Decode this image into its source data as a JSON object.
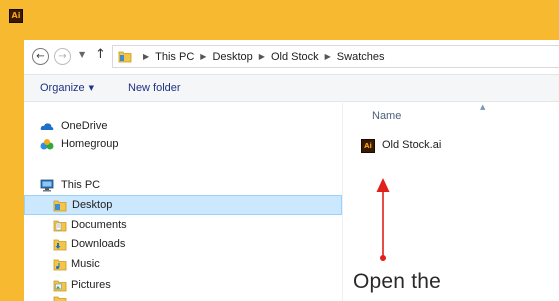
{
  "window": {
    "app_icon_text": "Ai",
    "accent_color": "#f6b92f"
  },
  "address_bar": {
    "back_icon": "back-arrow-icon",
    "forward_icon": "forward-arrow-icon",
    "up_icon": "up-arrow-icon",
    "breadcrumbs": [
      "This PC",
      "Desktop",
      "Old Stock",
      "Swatches"
    ]
  },
  "toolbar": {
    "organize_label": "Organize",
    "new_folder_label": "New folder"
  },
  "nav_pane": {
    "items": [
      {
        "label": "OneDrive",
        "icon": "onedrive-icon"
      },
      {
        "label": "Homegroup",
        "icon": "homegroup-icon"
      },
      {
        "label": "This PC",
        "icon": "computer-icon"
      },
      {
        "label": "Desktop",
        "icon": "desktop-folder-icon",
        "selected": true
      },
      {
        "label": "Documents",
        "icon": "documents-folder-icon"
      },
      {
        "label": "Downloads",
        "icon": "downloads-folder-icon"
      },
      {
        "label": "Music",
        "icon": "music-folder-icon"
      },
      {
        "label": "Pictures",
        "icon": "pictures-folder-icon"
      }
    ]
  },
  "file_list": {
    "column_header": "Name",
    "files": [
      {
        "name": "Old Stock.ai",
        "icon": "illustrator-file-icon",
        "icon_text": "Ai"
      }
    ]
  },
  "annotation": {
    "text": "Open the",
    "color": "#e0201b"
  }
}
